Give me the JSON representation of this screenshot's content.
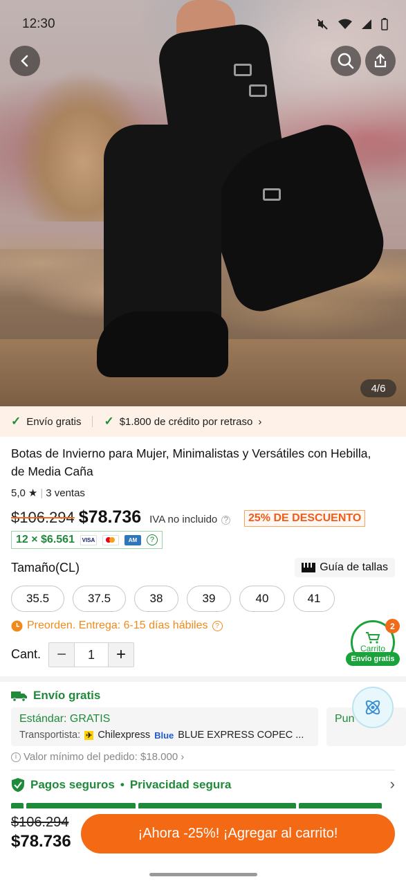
{
  "status_bar": {
    "time": "12:30"
  },
  "gallery": {
    "counter": "4/6"
  },
  "benefits": {
    "free_shipping": "Envío gratis",
    "credit": "$1.800 de crédito por retraso"
  },
  "product": {
    "title": "Botas de Invierno para Mujer, Minimalistas y Versátiles con Hebilla, de Media Caña",
    "rating": "5,0",
    "sales": "3 ventas",
    "old_price": "$106.294",
    "new_price": "$78.736",
    "iva": "IVA no incluido",
    "discount": "25% DE DESCUENTO",
    "installments": "12 × $6.561"
  },
  "sizes": {
    "label": "Tamaño(CL)",
    "guide": "Guía de tallas",
    "options": [
      "35.5",
      "37.5",
      "38",
      "39",
      "40",
      "41"
    ]
  },
  "preorder": "Preorden. Entrega: 6-15 días hábiles",
  "quantity": {
    "label": "Cant.",
    "value": "1"
  },
  "cart": {
    "label": "Carrito",
    "count": "2",
    "free": "Envío gratis"
  },
  "shipping": {
    "header": "Envío gratis",
    "standard": "Estándar: GRATIS",
    "carrier_label": "Transportista:",
    "carrier1": "Chilexpress",
    "carrier2": "BLUE EXPRESS COPEC ...",
    "option2": "Pun",
    "min_order": "Valor mínimo del pedido: $18.000"
  },
  "secure": {
    "payments": "Pagos seguros",
    "privacy": "Privacidad segura"
  },
  "bottom_bar": {
    "old_price": "$106.294",
    "new_price": "$78.736",
    "cta": "¡Ahora -25%! ¡Agregar al carrito!"
  },
  "colors": {
    "accent": "#f46a14",
    "green": "#1f8a3a"
  }
}
